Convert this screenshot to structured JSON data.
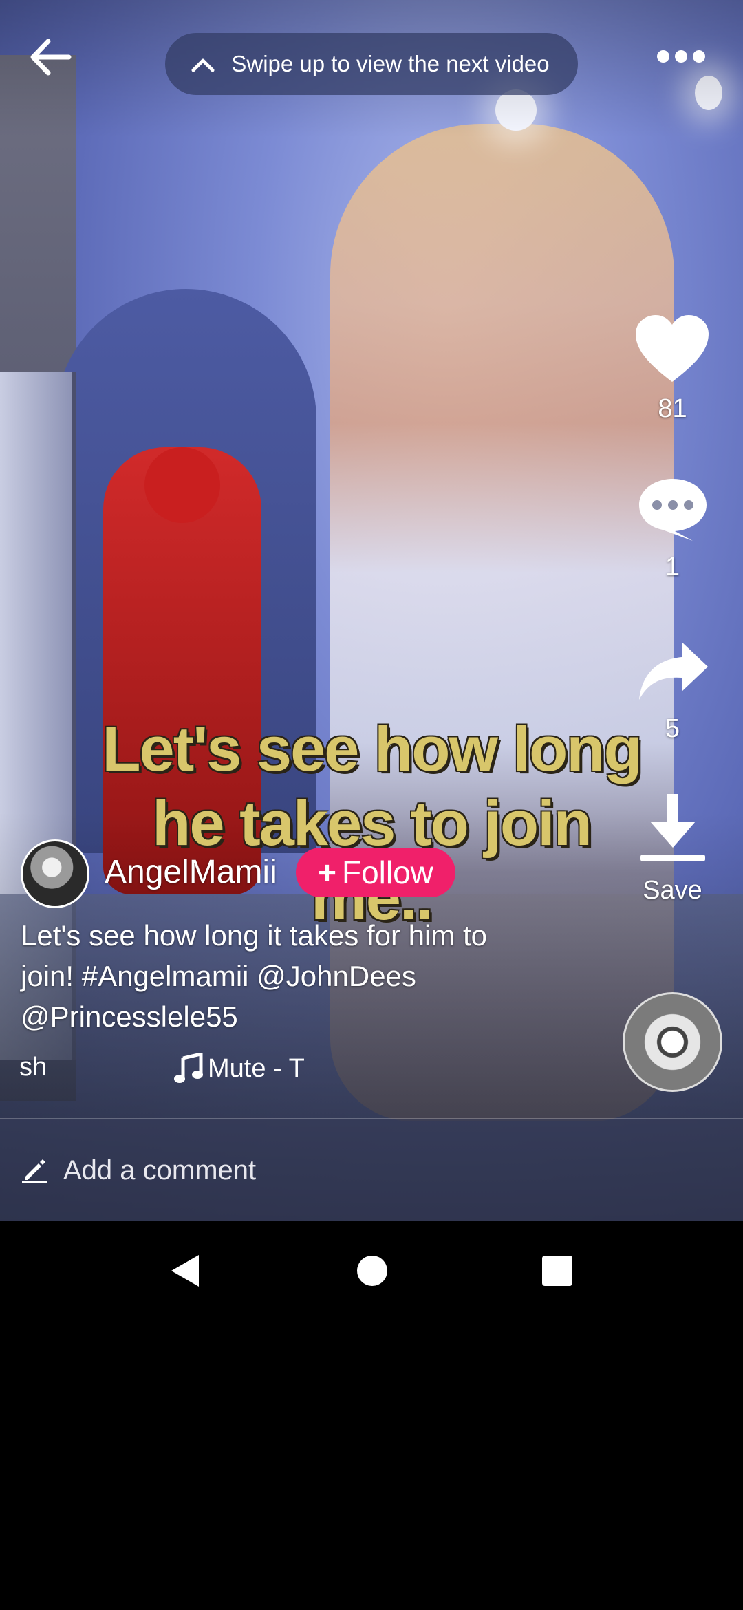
{
  "top_bar": {
    "swipe_hint": "Swipe up to view the next video"
  },
  "video": {
    "overlay_caption": "Let's see how long he takes to join me.."
  },
  "actions": {
    "likes": "81",
    "comments": "1",
    "shares": "5",
    "save_label": "Save"
  },
  "author": {
    "username": "AngelMamii",
    "follow_label": "Follow"
  },
  "post": {
    "description": "Let's see how long it takes for him to join! #Angelmamii @JohnDees @Princesslele55",
    "hashtag_snippet": "sh",
    "music": "Mute - T"
  },
  "comment_bar": {
    "placeholder": "Add a comment"
  },
  "colors": {
    "follow_bg": "#f0206a",
    "caption_yellow": "#d8c66b"
  }
}
